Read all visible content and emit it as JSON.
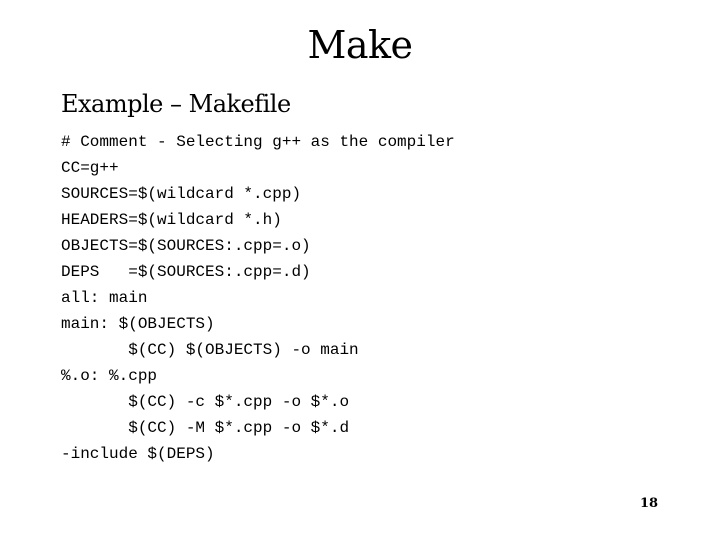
{
  "slide": {
    "title": "Make",
    "subtitle": "Example – Makefile",
    "code_lines": [
      "# Comment - Selecting g++ as the compiler",
      "CC=g++",
      "SOURCES=$(wildcard *.cpp)",
      "HEADERS=$(wildcard *.h)",
      "OBJECTS=$(SOURCES:.cpp=.o)",
      "DEPS   =$(SOURCES:.cpp=.d)",
      "all: main",
      "main: $(OBJECTS)",
      "       $(CC) $(OBJECTS) -o main",
      "%.o: %.cpp",
      "       $(CC) -c $*.cpp -o $*.o",
      "       $(CC) -M $*.cpp -o $*.d",
      "-include $(DEPS)"
    ],
    "page_number": "18"
  }
}
